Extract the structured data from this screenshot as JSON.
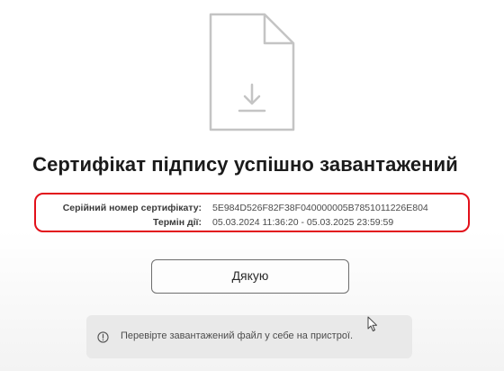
{
  "title": "Сертифікат підпису успішно завантажений",
  "certificate": {
    "serial_label": "Серійний номер сертифікату:",
    "serial_value": "5E984D526F82F38F040000005B7851011226E804",
    "term_label": "Термін дії:",
    "term_value": "05.03.2024 11:36:20 - 05.03.2025 23:59:59"
  },
  "buttons": {
    "thanks_label": "Дякую"
  },
  "notice": {
    "text": "Перевірте завантажений файл у себе на пристрої.",
    "icon": "info-circle-icon"
  },
  "icons": {
    "document": "document-download-icon",
    "cursor": "mouse-cursor-icon"
  },
  "colors": {
    "highlight_border": "#e2101a",
    "title_text": "#1b1b1b",
    "notice_bg": "#e9e9e9",
    "icon_stroke": "#c4c4c4"
  }
}
